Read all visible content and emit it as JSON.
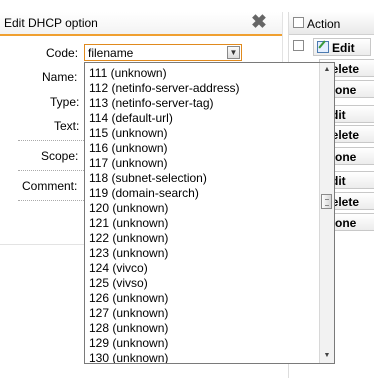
{
  "dialog": {
    "title": "Edit DHCP option",
    "labels": {
      "code": "Code:",
      "name": "Name:",
      "type": "Type:",
      "text": "Text:",
      "scope": "Scope:",
      "comment": "Comment:"
    },
    "code_select_value": "filename"
  },
  "dropdown": {
    "options": [
      "111 (unknown)",
      "112 (netinfo-server-address)",
      "113 (netinfo-server-tag)",
      "114 (default-url)",
      "115 (unknown)",
      "116 (unknown)",
      "117 (unknown)",
      "118 (subnet-selection)",
      "119 (domain-search)",
      "120 (unknown)",
      "121 (unknown)",
      "122 (unknown)",
      "123 (unknown)",
      "124 (vivco)",
      "125 (vivso)",
      "126 (unknown)",
      "127 (unknown)",
      "128 (unknown)",
      "129 (unknown)",
      "130 (unknown)"
    ]
  },
  "right_panel": {
    "header": "Action",
    "actions": [
      {
        "label": "Edit"
      },
      {
        "label": "Delete"
      },
      {
        "label": "Clone"
      },
      {
        "label": "Edit"
      },
      {
        "label": "Delete"
      },
      {
        "label": "Clone"
      },
      {
        "label": "Edit"
      },
      {
        "label": "Delete"
      },
      {
        "label": "Clone"
      }
    ]
  }
}
